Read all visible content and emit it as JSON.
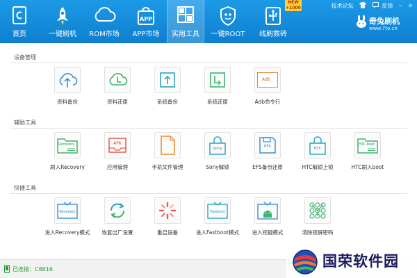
{
  "nav": [
    {
      "label": "首页",
      "icon": "home-icon"
    },
    {
      "label": "一键刷机",
      "icon": "rocket-icon"
    },
    {
      "label": "ROM市场",
      "icon": "cloud-icon"
    },
    {
      "label": "APP市场",
      "icon": "app-bag-icon"
    },
    {
      "label": "实用工具",
      "icon": "grid-icon"
    },
    {
      "label": "一键ROOT",
      "icon": "shield-icon"
    },
    {
      "label": "线刷救砖",
      "icon": "usb-icon"
    }
  ],
  "badge": {
    "line1": "NEW",
    "line2": "+1000"
  },
  "top_links": {
    "forum": "技术论坛",
    "feedback": "反馈"
  },
  "brand": {
    "name": "奇兔刷机",
    "url": "www.7to.cn"
  },
  "sections": [
    {
      "title": "设备管理",
      "tools": [
        {
          "label": "资料备份",
          "icon": "cloud-upload-icon"
        },
        {
          "label": "资料还原",
          "icon": "cloud-restore-icon"
        },
        {
          "label": "系统备份",
          "icon": "system-backup-icon"
        },
        {
          "label": "系统还原",
          "icon": "system-restore-icon"
        },
        {
          "label": "Adb命令行",
          "icon": "adb-terminal-icon",
          "icon_text": "Adb_"
        }
      ]
    },
    {
      "title": "辅助工具",
      "tools": [
        {
          "label": "刷入Recovery",
          "icon": "recovery-folder-icon",
          "icon_text": "Recovery"
        },
        {
          "label": "应用管理",
          "icon": "apk-tray-icon",
          "icon_text": "APK"
        },
        {
          "label": "手机文件管理",
          "icon": "file-icon"
        },
        {
          "label": "Sony解锁",
          "icon": "sony-lock-icon",
          "icon_text": "Sony"
        },
        {
          "label": "EFS备份还原",
          "icon": "efs-save-icon",
          "icon_text": "EFS"
        },
        {
          "label": "HTC解锁上锁",
          "icon": "htc-lock-icon",
          "icon_text": "HTC"
        },
        {
          "label": "HTC刷入boot",
          "icon": "htc-boot-folder-icon",
          "icon_text": "HTC-boot"
        }
      ]
    },
    {
      "title": "快捷工具",
      "tools": [
        {
          "label": "进入Recovery模式",
          "icon": "recovery-mode-icon",
          "icon_text": "Recovery"
        },
        {
          "label": "恢复出厂设置",
          "icon": "factory-reset-icon"
        },
        {
          "label": "重启设备",
          "icon": "reboot-spinner-icon"
        },
        {
          "label": "进入Fastboot模式",
          "icon": "fastboot-icon",
          "icon_text": "Fastboot"
        },
        {
          "label": "进入挖掘模式",
          "icon": "android-download-icon"
        },
        {
          "label": "清除锁屏密码",
          "icon": "pattern-lock-icon"
        }
      ]
    }
  ],
  "status": {
    "text": "已连接：C8816",
    "icon": "phone-icon"
  },
  "watermark": {
    "text": "国荣软件园",
    "icon": "watermark-globe-icon"
  },
  "colors": {
    "topbar": "#1589db",
    "icon_blue": "#3a8fd8",
    "icon_green": "#3cb46e",
    "icon_orange": "#f08a2c",
    "icon_red": "#e85a4f",
    "status_green": "#2a9a3a"
  }
}
